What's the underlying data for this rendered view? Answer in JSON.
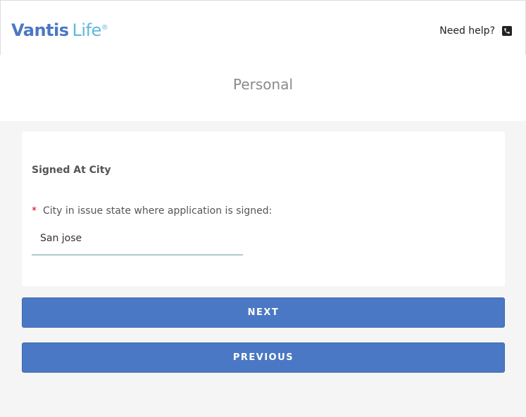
{
  "header": {
    "logo": {
      "brand": "Vantis",
      "product": "Life",
      "mark": "®"
    },
    "help_label": "Need help?",
    "help_icon": "phone-icon"
  },
  "section": {
    "title": "Personal"
  },
  "card": {
    "title": "Signed At City",
    "field": {
      "required_mark": "*",
      "label": "City in issue state where application is signed:",
      "value": "San jose",
      "placeholder": ""
    }
  },
  "buttons": {
    "next_label": "NEXT",
    "previous_label": "PREVIOUS"
  },
  "colors": {
    "brand_blue": "#4a78c4",
    "brand_light_blue": "#5fb7dc",
    "required_red": "#d0021b",
    "background": "#f5f5f5"
  }
}
